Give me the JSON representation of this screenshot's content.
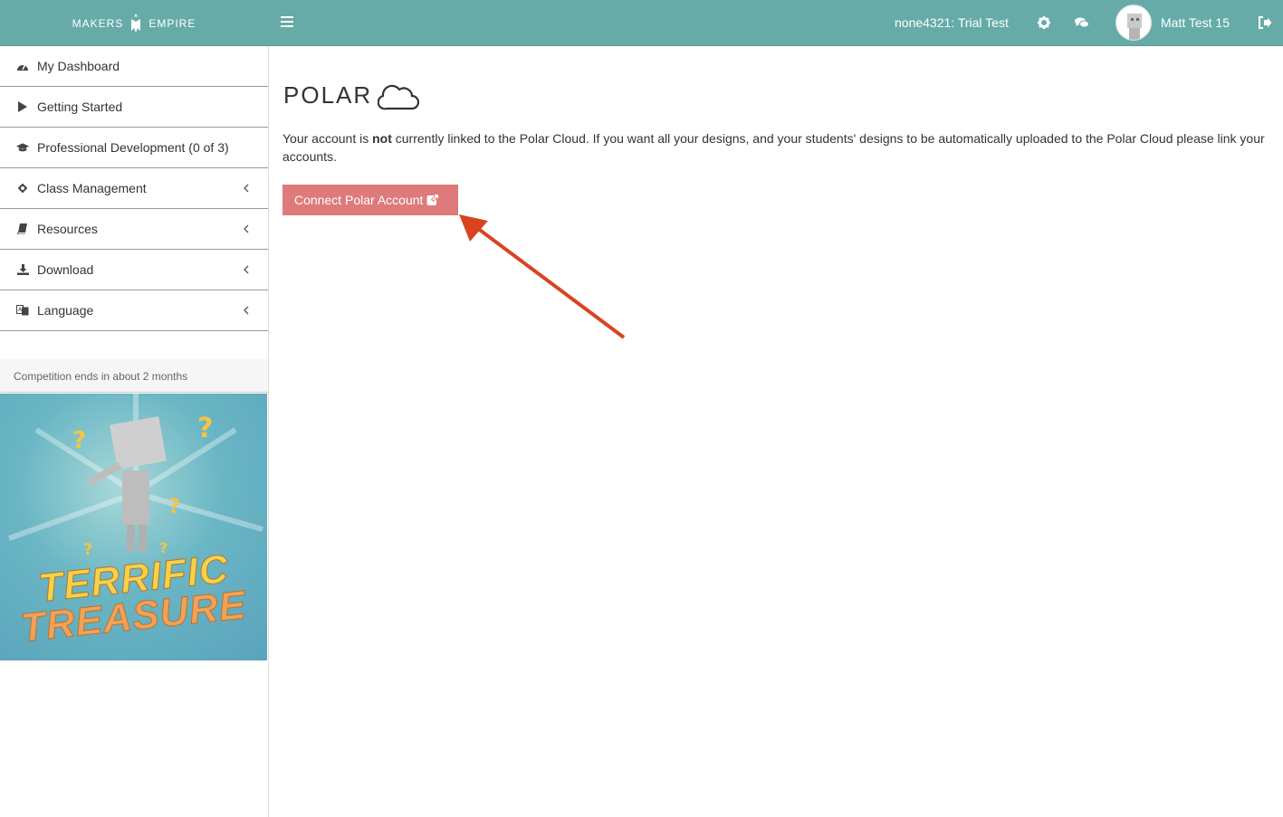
{
  "app": {
    "logo_left": "MAKERS",
    "logo_right": "EMPIRE"
  },
  "header": {
    "school": "none4321: Trial Test",
    "username": "Matt Test 15",
    "icons": [
      "menu-icon",
      "gear-icon",
      "chat-icon",
      "logout-icon"
    ]
  },
  "sidebar": {
    "items": [
      {
        "label": "My Dashboard",
        "icon": "dashboard-icon"
      },
      {
        "label": "Getting Started",
        "icon": "play-icon"
      },
      {
        "label": "Professional Development (0 of 3)",
        "icon": "graduation-cap-icon"
      },
      {
        "label": "Class Management",
        "icon": "gear-icon"
      },
      {
        "label": "Resources",
        "icon": "book-icon"
      },
      {
        "label": "Download",
        "icon": "download-icon"
      },
      {
        "label": "Language",
        "icon": "language-icon"
      }
    ],
    "competition": "Competition ends in about 2 months",
    "promo": {
      "line1": "TERRIFIC",
      "line2": "TREASURE"
    }
  },
  "main": {
    "logo_text": "POLAR",
    "message_before": "Your account is ",
    "message_bold": "not",
    "message_after": " currently linked to the Polar Cloud. If you want all your designs, and your students' designs to be automatically uploaded to the Polar Cloud please link your accounts.",
    "connect_label": "Connect Polar Account"
  },
  "colors": {
    "topbar": "#66aba8",
    "button": "#de7a7a",
    "arrow": "#d9441f"
  }
}
